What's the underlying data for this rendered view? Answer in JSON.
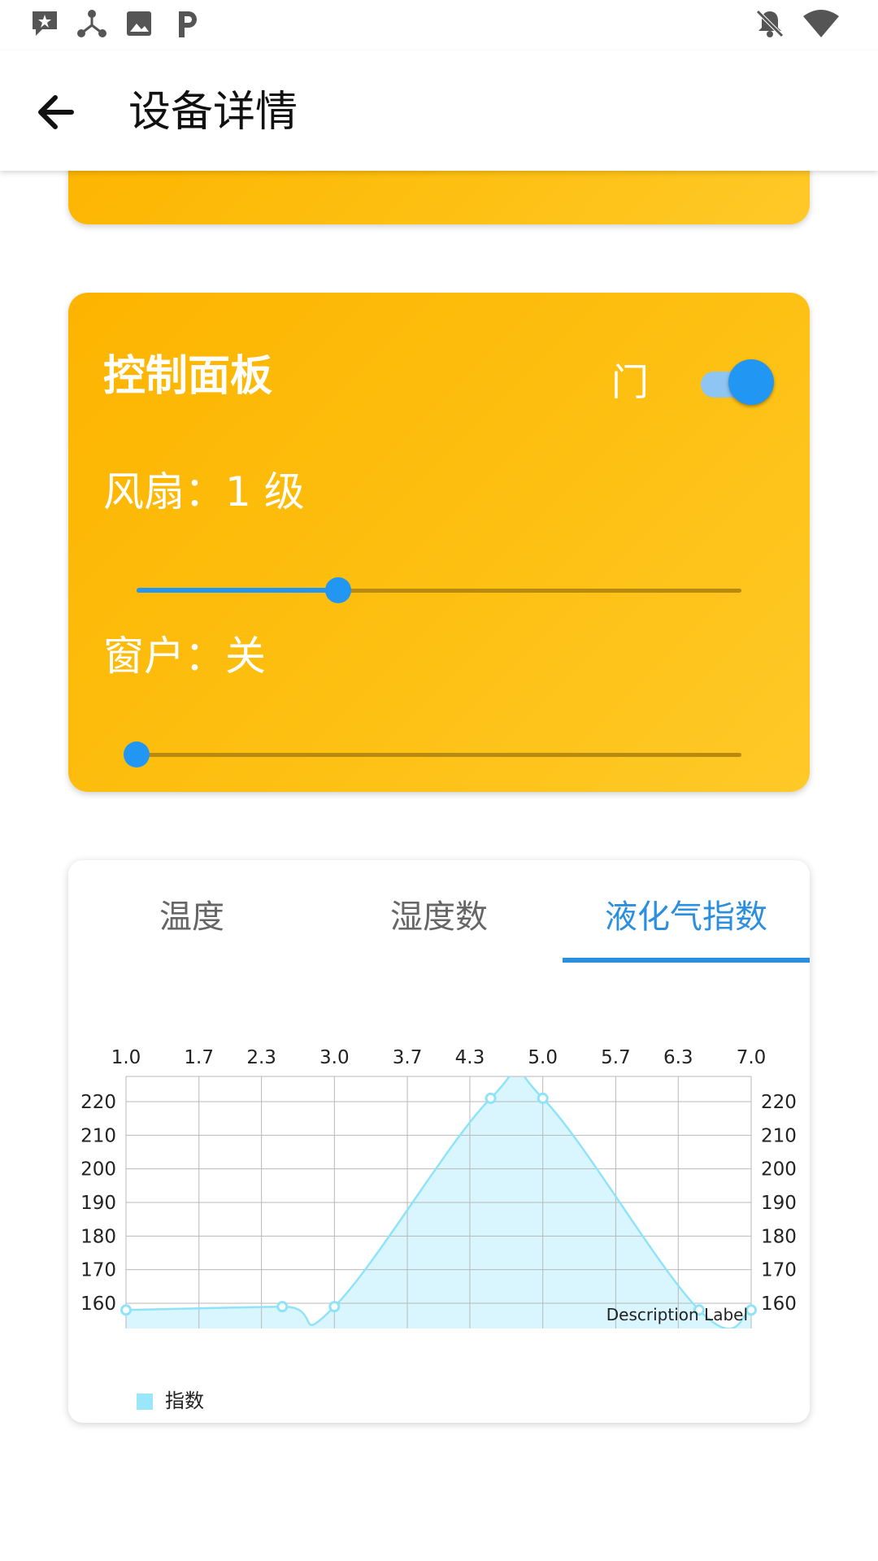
{
  "status_bar": {
    "left_icons": [
      "chat-star-icon",
      "share-nodes-icon",
      "image-icon",
      "parking-icon"
    ],
    "right_icons": [
      "bell-off-icon",
      "wifi-icon"
    ]
  },
  "app_bar": {
    "title": "设备详情",
    "back_icon": "arrow-left-icon"
  },
  "control_panel": {
    "title": "控制面板",
    "door": {
      "label": "门",
      "on": true
    },
    "fan": {
      "label": "风扇：1 级",
      "value": 0.333
    },
    "window": {
      "label": "窗户：关",
      "value": 0.0
    }
  },
  "chart_tabs": {
    "items": [
      "温度",
      "湿度数",
      "液化气指数"
    ],
    "active": 2
  },
  "chart_data": {
    "type": "area",
    "x": [
      1.0,
      2.5,
      3.0,
      4.5,
      5.0,
      6.5,
      7.0
    ],
    "series": [
      {
        "name": "指数",
        "values": [
          158,
          159,
          159,
          221,
          221,
          158,
          158
        ]
      }
    ],
    "x_ticks": [
      "1.0",
      "1.7",
      "2.3",
      "3.0",
      "3.7",
      "4.3",
      "5.0",
      "5.7",
      "6.3",
      "7.0"
    ],
    "y_ticks": [
      "160",
      "170",
      "180",
      "190",
      "200",
      "210",
      "220"
    ],
    "xlim": [
      1.0,
      7.0
    ],
    "ylim": [
      152.5,
      227.5
    ],
    "x_axis_position": "top",
    "y_axis": "left-and-right",
    "grid": true,
    "legend": "bottom-left",
    "description": "Description Label",
    "colors": {
      "line": "#8fe3f8",
      "fill": "#d9f5fd",
      "grid": "#b9b9b9"
    }
  }
}
